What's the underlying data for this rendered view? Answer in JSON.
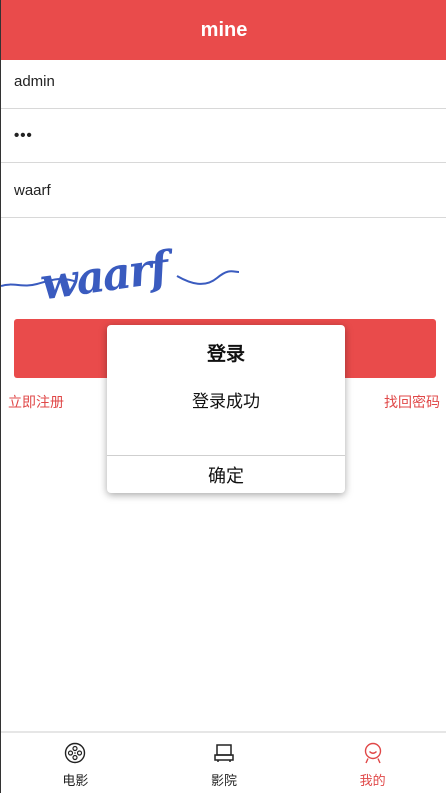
{
  "header": {
    "title": "mine"
  },
  "form": {
    "username_value": "admin",
    "password_value": "•••",
    "captcha_input_value": "waarf"
  },
  "captcha_image": {
    "text": "waarf"
  },
  "links": {
    "register": "立即注册",
    "forgot": "找回密码"
  },
  "dialog": {
    "title": "登录",
    "message": "登录成功",
    "ok_label": "确定"
  },
  "tabbar": {
    "items": [
      {
        "label": "电影",
        "icon": "film-reel-icon",
        "active": false
      },
      {
        "label": "影院",
        "icon": "cinema-seat-icon",
        "active": false
      },
      {
        "label": "我的",
        "icon": "user-face-icon",
        "active": true
      }
    ]
  },
  "colors": {
    "brand": "#e94b4b",
    "link": "#e04848",
    "captcha": "#3a5bbf"
  }
}
